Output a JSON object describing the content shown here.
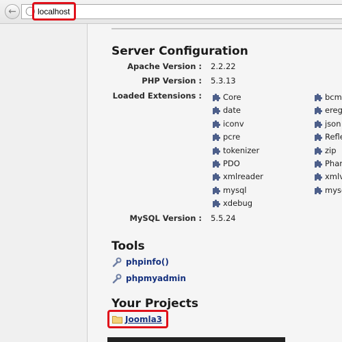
{
  "browser": {
    "url": "localhost",
    "highlight_color": "#e0101a"
  },
  "server_config": {
    "heading": "Server Configuration",
    "apache_label": "Apache Version :",
    "apache_value": "2.2.22",
    "php_label": "PHP Version :",
    "php_value": "5.3.13",
    "extensions_label": "Loaded Extensions :",
    "extensions_col1": [
      "Core",
      "date",
      "iconv",
      "pcre",
      "tokenizer",
      "PDO",
      "xmlreader",
      "mysql",
      "xdebug"
    ],
    "extensions_col2": [
      "bcma",
      "ereg",
      "json",
      "Refle",
      "zip",
      "Phar",
      "xmlv",
      "mysq"
    ],
    "mysql_label": "MySQL Version :",
    "mysql_value": "5.5.24"
  },
  "tools": {
    "heading": "Tools",
    "items": [
      "phpinfo()",
      "phpmyadmin"
    ]
  },
  "projects": {
    "heading": "Your Projects",
    "items": [
      "Joomla3"
    ]
  },
  "colors": {
    "link": "#15317e",
    "extension_icon": "#4d5f8a"
  }
}
